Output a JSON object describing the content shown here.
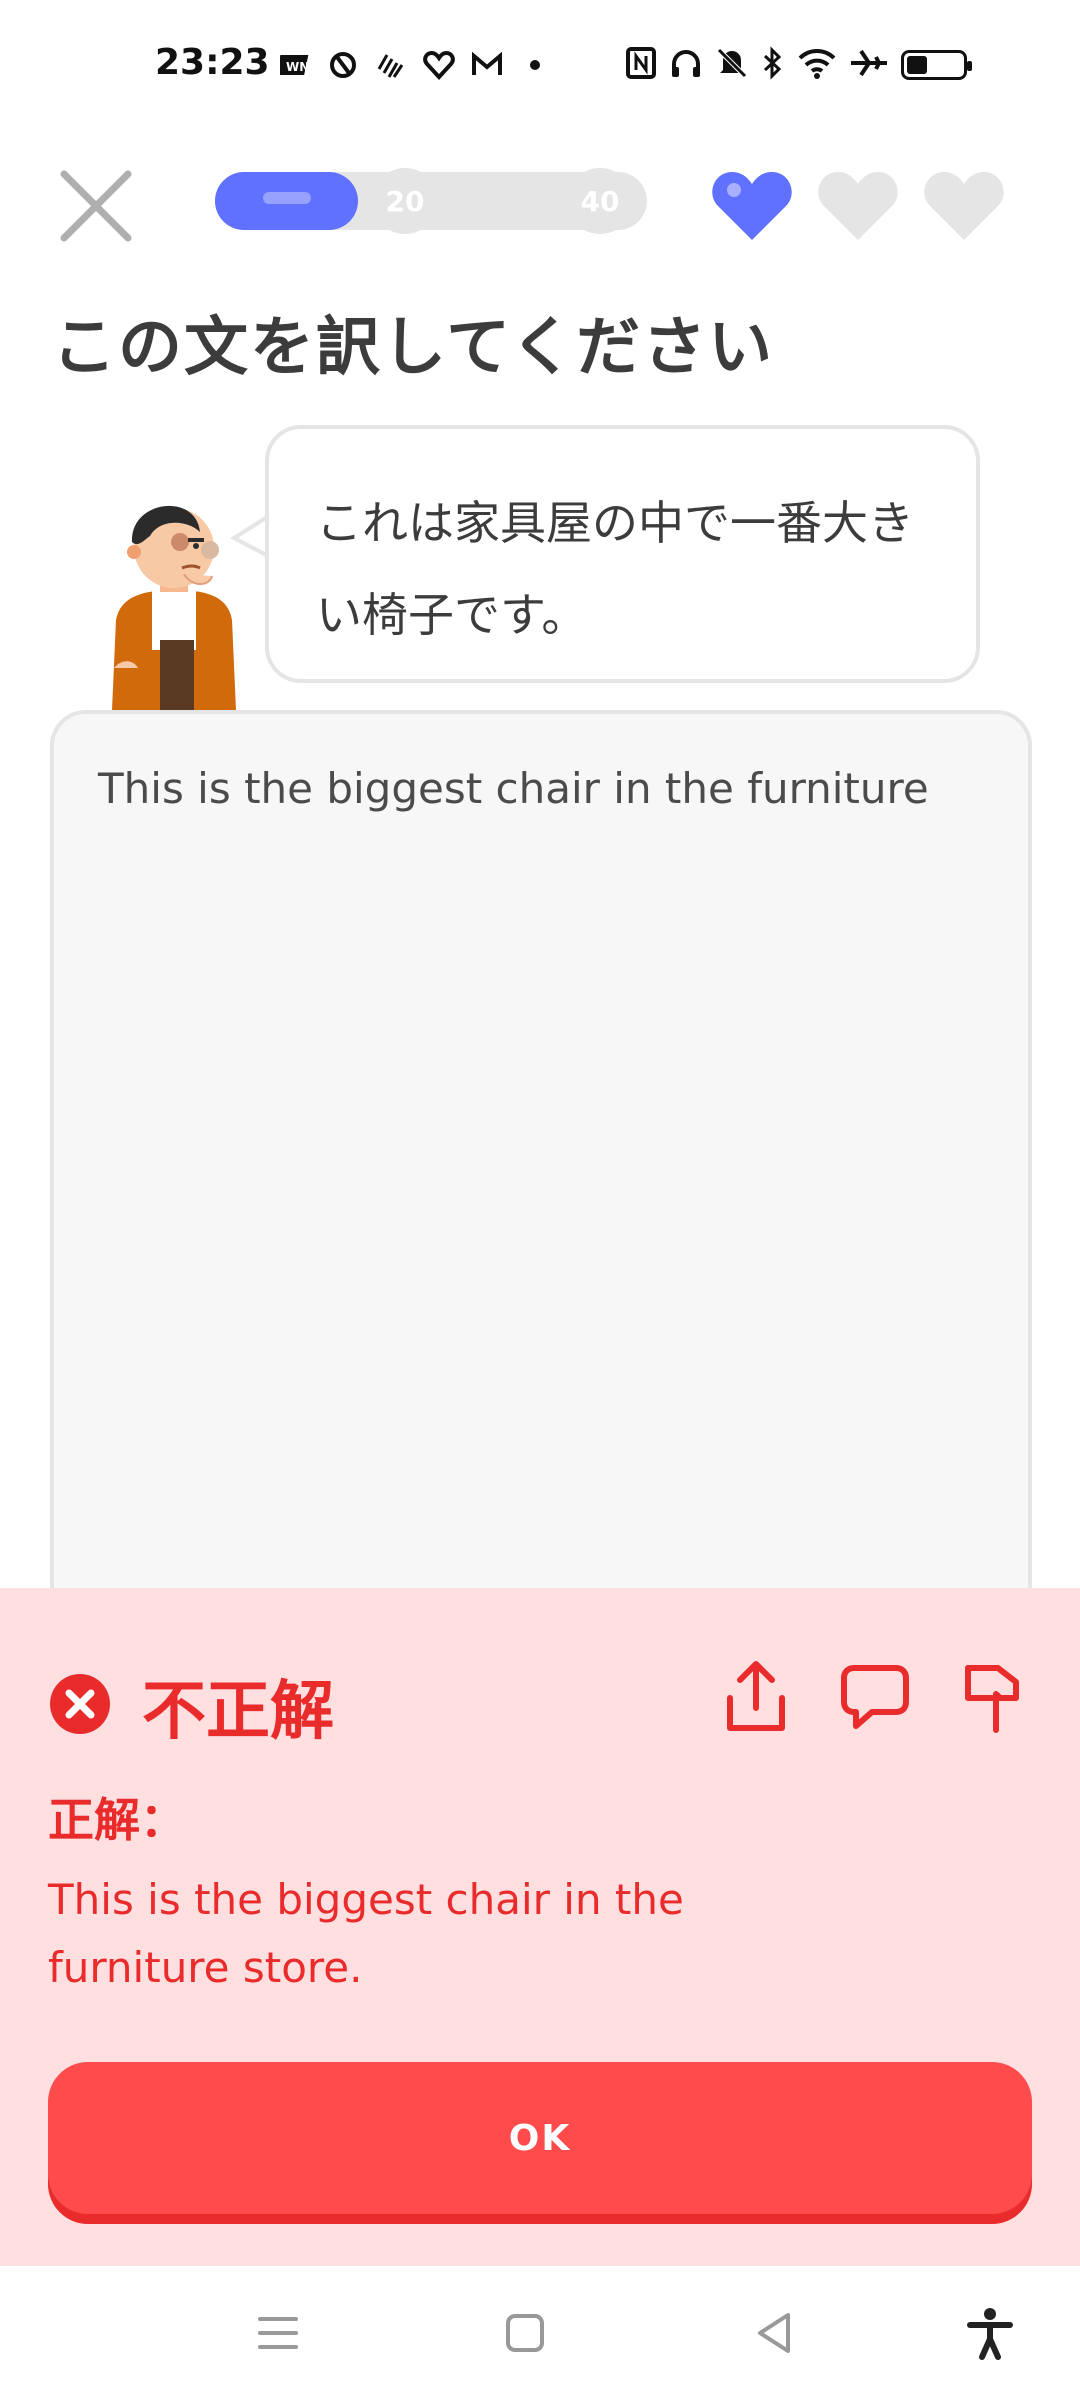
{
  "status_bar": {
    "time": "23:23",
    "icons": [
      "wn-icon",
      "sync-icon",
      "wave-icon",
      "heart-health-icon",
      "gmail-icon",
      "dot-icon",
      "nfc-icon",
      "headphones-icon",
      "mute-icon",
      "bluetooth-icon",
      "wifi-icon",
      "airplane-icon",
      "battery-icon"
    ],
    "battery_level": 0.35
  },
  "header": {
    "progress_fraction": 0.33,
    "milestone_1": "20",
    "milestone_2": "40",
    "hearts_total": 3,
    "hearts_filled": 1
  },
  "prompt": {
    "title": "この文を訳してください",
    "sentence_line1": "これは家具屋の中で一番大き",
    "sentence_line2": "い椅子です。"
  },
  "answer": {
    "user_text": "This is the biggest chair in the furniture"
  },
  "feedback": {
    "heading": "不正解",
    "label": "正解：",
    "correct_line1": "This is the biggest chair in the",
    "correct_line2": "furniture store.",
    "ok_label": "OK"
  },
  "colors": {
    "accent": "#6070ff",
    "error": "#ea2b2b",
    "error_bg": "#ffdfe0",
    "button": "#ff4b4b"
  }
}
